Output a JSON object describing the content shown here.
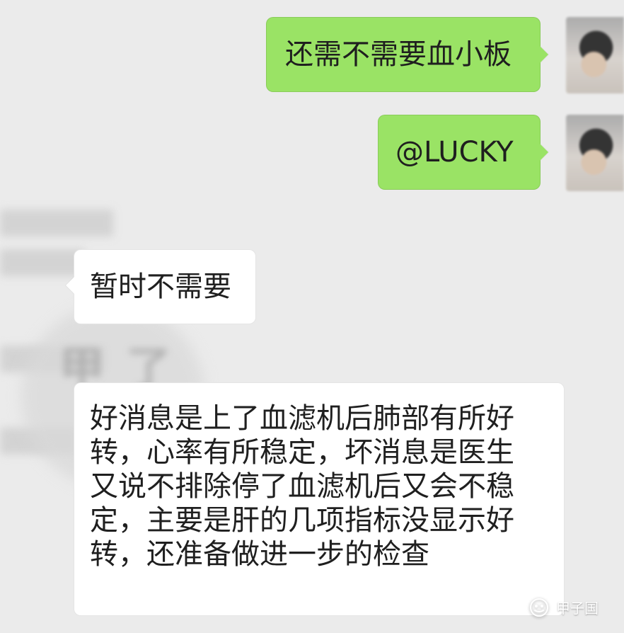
{
  "conversation": {
    "messages": [
      {
        "sender": "self",
        "text": "还需不需要血小板"
      },
      {
        "sender": "self",
        "text": "@LUCKY"
      },
      {
        "sender": "other",
        "text": "暂时不需要"
      },
      {
        "sender": "other",
        "text": "好消息是上了血滤机后肺部有所好\n转，心率有所稳定，坏消息是医生\n又说不排除停了血滤机后又会不稳\n定，主要是肝的几项指标没显示好\n转，还准备做进一步的检查"
      }
    ]
  },
  "watermark": {
    "text": "甲子国",
    "icon": "wechat-official-account-icon"
  },
  "colors": {
    "background": "#ebebeb",
    "self_bubble": "#9ae365",
    "other_bubble": "#ffffff",
    "text": "#1f1f1f"
  }
}
